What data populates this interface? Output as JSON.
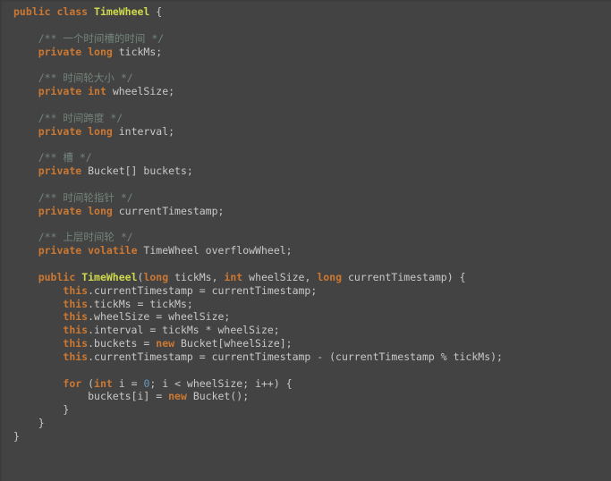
{
  "editor": {
    "language": "Java",
    "theme": "darcula-like",
    "background_color": "#434343",
    "default_text_color": "#c8c8c8",
    "keyword_color": "#cc7832",
    "comment_color": "#73857b",
    "class_name_color": "#cfd94c",
    "number_color": "#6897bb",
    "class_name": "TimeWheel",
    "font_family_kind": "monospace"
  },
  "code": {
    "lines": [
      {
        "indent": 0,
        "tokens": [
          {
            "t": "public",
            "c": "kw"
          },
          {
            "t": " ",
            "c": "plain"
          },
          {
            "t": "class",
            "c": "kw"
          },
          {
            "t": " ",
            "c": "plain"
          },
          {
            "t": "TimeWheel",
            "c": "cls"
          },
          {
            "t": " {",
            "c": "punct"
          }
        ]
      },
      {
        "indent": 0,
        "tokens": []
      },
      {
        "indent": 1,
        "tokens": [
          {
            "t": "/** 一个时间槽的时间 */",
            "c": "cmt"
          }
        ]
      },
      {
        "indent": 1,
        "tokens": [
          {
            "t": "private",
            "c": "kw"
          },
          {
            "t": " ",
            "c": "plain"
          },
          {
            "t": "long",
            "c": "kw"
          },
          {
            "t": " tickMs;",
            "c": "plain"
          }
        ]
      },
      {
        "indent": 0,
        "tokens": []
      },
      {
        "indent": 1,
        "tokens": [
          {
            "t": "/** 时间轮大小 */",
            "c": "cmt"
          }
        ]
      },
      {
        "indent": 1,
        "tokens": [
          {
            "t": "private",
            "c": "kw"
          },
          {
            "t": " ",
            "c": "plain"
          },
          {
            "t": "int",
            "c": "kw"
          },
          {
            "t": " wheelSize;",
            "c": "plain"
          }
        ]
      },
      {
        "indent": 0,
        "tokens": []
      },
      {
        "indent": 1,
        "tokens": [
          {
            "t": "/** 时间跨度 */",
            "c": "cmt"
          }
        ]
      },
      {
        "indent": 1,
        "tokens": [
          {
            "t": "private",
            "c": "kw"
          },
          {
            "t": " ",
            "c": "plain"
          },
          {
            "t": "long",
            "c": "kw"
          },
          {
            "t": " interval;",
            "c": "plain"
          }
        ]
      },
      {
        "indent": 0,
        "tokens": []
      },
      {
        "indent": 1,
        "tokens": [
          {
            "t": "/** 槽 */",
            "c": "cmt"
          }
        ]
      },
      {
        "indent": 1,
        "tokens": [
          {
            "t": "private",
            "c": "kw"
          },
          {
            "t": " Bucket[] buckets;",
            "c": "plain"
          }
        ]
      },
      {
        "indent": 0,
        "tokens": []
      },
      {
        "indent": 1,
        "tokens": [
          {
            "t": "/** 时间轮指针 */",
            "c": "cmt"
          }
        ]
      },
      {
        "indent": 1,
        "tokens": [
          {
            "t": "private",
            "c": "kw"
          },
          {
            "t": " ",
            "c": "plain"
          },
          {
            "t": "long",
            "c": "kw"
          },
          {
            "t": " currentTimestamp;",
            "c": "plain"
          }
        ]
      },
      {
        "indent": 0,
        "tokens": []
      },
      {
        "indent": 1,
        "tokens": [
          {
            "t": "/** 上层时间轮 */",
            "c": "cmt"
          }
        ]
      },
      {
        "indent": 1,
        "tokens": [
          {
            "t": "private",
            "c": "kw"
          },
          {
            "t": " ",
            "c": "plain"
          },
          {
            "t": "volatile",
            "c": "kw"
          },
          {
            "t": " TimeWheel overflowWheel;",
            "c": "plain"
          }
        ]
      },
      {
        "indent": 0,
        "tokens": []
      },
      {
        "indent": 1,
        "tokens": [
          {
            "t": "public",
            "c": "kw"
          },
          {
            "t": " ",
            "c": "plain"
          },
          {
            "t": "TimeWheel",
            "c": "cls"
          },
          {
            "t": "(",
            "c": "punct"
          },
          {
            "t": "long",
            "c": "kw"
          },
          {
            "t": " tickMs, ",
            "c": "plain"
          },
          {
            "t": "int",
            "c": "kw"
          },
          {
            "t": " wheelSize, ",
            "c": "plain"
          },
          {
            "t": "long",
            "c": "kw"
          },
          {
            "t": " currentTimestamp) {",
            "c": "plain"
          }
        ]
      },
      {
        "indent": 2,
        "tokens": [
          {
            "t": "this",
            "c": "kw"
          },
          {
            "t": ".currentTimestamp = currentTimestamp;",
            "c": "plain"
          }
        ]
      },
      {
        "indent": 2,
        "tokens": [
          {
            "t": "this",
            "c": "kw"
          },
          {
            "t": ".tickMs = tickMs;",
            "c": "plain"
          }
        ]
      },
      {
        "indent": 2,
        "tokens": [
          {
            "t": "this",
            "c": "kw"
          },
          {
            "t": ".wheelSize = wheelSize;",
            "c": "plain"
          }
        ]
      },
      {
        "indent": 2,
        "tokens": [
          {
            "t": "this",
            "c": "kw"
          },
          {
            "t": ".interval = tickMs * wheelSize;",
            "c": "plain"
          }
        ]
      },
      {
        "indent": 2,
        "tokens": [
          {
            "t": "this",
            "c": "kw"
          },
          {
            "t": ".buckets = ",
            "c": "plain"
          },
          {
            "t": "new",
            "c": "kw"
          },
          {
            "t": " Bucket[wheelSize];",
            "c": "plain"
          }
        ]
      },
      {
        "indent": 2,
        "tokens": [
          {
            "t": "this",
            "c": "kw"
          },
          {
            "t": ".currentTimestamp = currentTimestamp - (currentTimestamp % tickMs);",
            "c": "plain"
          }
        ]
      },
      {
        "indent": 0,
        "tokens": []
      },
      {
        "indent": 2,
        "tokens": [
          {
            "t": "for",
            "c": "kw"
          },
          {
            "t": " (",
            "c": "punct"
          },
          {
            "t": "int",
            "c": "kw"
          },
          {
            "t": " i = ",
            "c": "plain"
          },
          {
            "t": "0",
            "c": "num"
          },
          {
            "t": "; i < wheelSize; i++) {",
            "c": "plain"
          }
        ]
      },
      {
        "indent": 3,
        "tokens": [
          {
            "t": "buckets[i] = ",
            "c": "plain"
          },
          {
            "t": "new",
            "c": "kw"
          },
          {
            "t": " Bucket();",
            "c": "plain"
          }
        ]
      },
      {
        "indent": 2,
        "tokens": [
          {
            "t": "}",
            "c": "punct"
          }
        ]
      },
      {
        "indent": 1,
        "tokens": [
          {
            "t": "}",
            "c": "punct"
          }
        ]
      },
      {
        "indent": 0,
        "tokens": [
          {
            "t": "}",
            "c": "punct"
          }
        ]
      }
    ]
  }
}
